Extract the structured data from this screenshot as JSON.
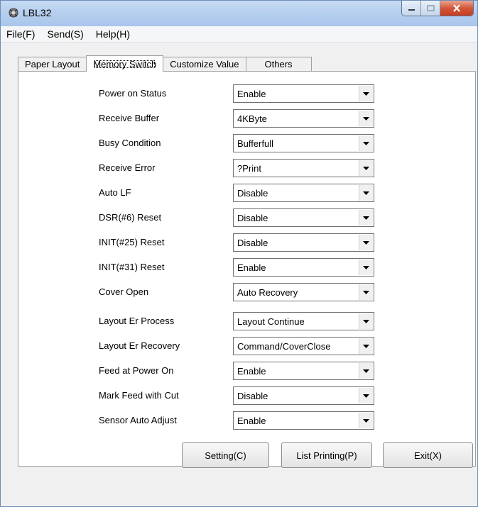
{
  "window": {
    "title": "LBL32",
    "app_icon": "printer-gear-icon",
    "caption_icons": [
      "minimize-icon",
      "maximize-icon",
      "close-icon"
    ]
  },
  "menu": {
    "file": "File(F)",
    "send": "Send(S)",
    "help": "Help(H)"
  },
  "tabs": {
    "paper_layout": "Paper Layout",
    "memory_switch": "Memory Switch",
    "customize_value": "Customize Value",
    "others": "Others",
    "selected": "Memory Switch"
  },
  "settings": [
    {
      "label": "Power on Status",
      "value": "Enable"
    },
    {
      "label": "Receive Buffer",
      "value": "4KByte"
    },
    {
      "label": "Busy Condition",
      "value": "Bufferfull"
    },
    {
      "label": "Receive Error",
      "value": "?Print"
    },
    {
      "label": "Auto LF",
      "value": "Disable"
    },
    {
      "label": "DSR(#6) Reset",
      "value": "Disable"
    },
    {
      "label": "INIT(#25) Reset",
      "value": "Disable"
    },
    {
      "label": "INIT(#31) Reset",
      "value": "Enable"
    },
    {
      "label": "Cover Open",
      "value": "Auto Recovery"
    },
    {
      "label": "Layout Er Process",
      "value": "Layout Continue"
    },
    {
      "label": "Layout Er Recovery",
      "value": "Command/CoverClose"
    },
    {
      "label": "Feed at Power On",
      "value": "Enable"
    },
    {
      "label": "Mark Feed with Cut",
      "value": "Disable"
    },
    {
      "label": "Sensor Auto Adjust",
      "value": "Enable"
    }
  ],
  "buttons": {
    "setting": "Setting(C)",
    "list_printing": "List Printing(P)",
    "exit": "Exit(X)"
  }
}
